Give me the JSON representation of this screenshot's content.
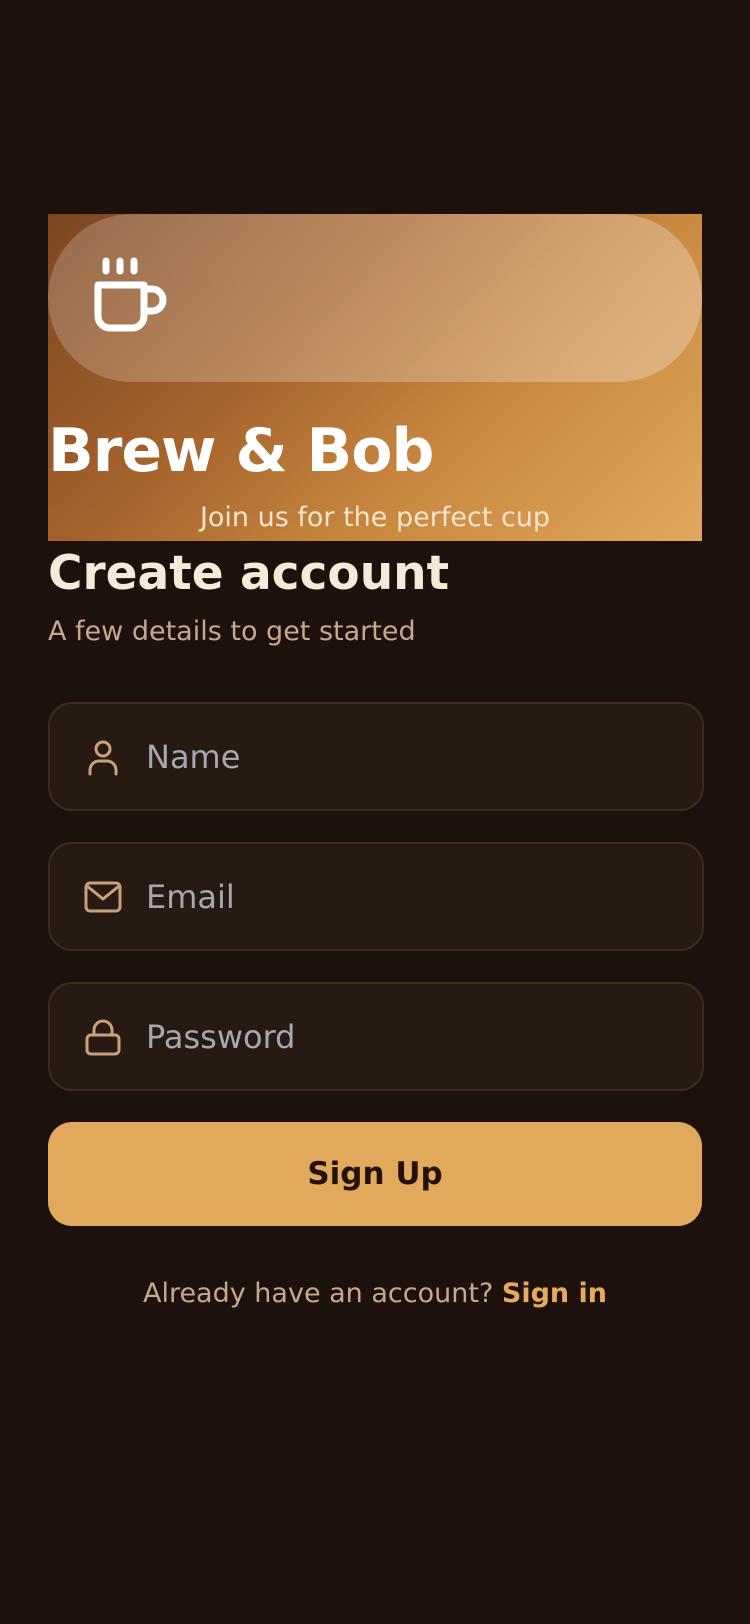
{
  "hero": {
    "title": "Brew & Bob",
    "subtitle": "Join us for the perfect cup",
    "icon": "coffee-cup-icon"
  },
  "form": {
    "heading": "Create account",
    "subheading": "A few details to get started",
    "fields": [
      {
        "icon": "user-icon",
        "placeholder": "Name",
        "value": ""
      },
      {
        "icon": "mail-icon",
        "placeholder": "Email",
        "value": ""
      },
      {
        "icon": "lock-icon",
        "placeholder": "Password",
        "value": ""
      }
    ],
    "submit_label": "Sign Up"
  },
  "footer": {
    "prompt": "Already have an account?",
    "link": "Sign in"
  },
  "colors": {
    "background": "#1c110d",
    "accent": "#e2a95c",
    "field_bg": "#271a13",
    "field_border": "#3d2b20",
    "heading_text": "#f6ead8",
    "muted_text": "#c6a88b"
  }
}
